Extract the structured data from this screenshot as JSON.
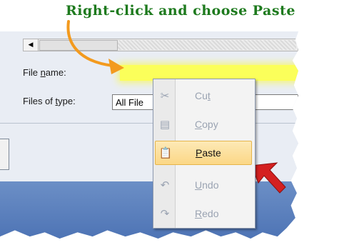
{
  "caption": {
    "text": "Right-click and choose Paste",
    "color": "#1e7a1e"
  },
  "dialog": {
    "scroll_left_glyph": "◀",
    "file_name_label_pre": "File ",
    "file_name_label_u": "n",
    "file_name_label_post": "ame:",
    "files_of_type_label_pre": "Files of ",
    "files_of_type_label_u": "t",
    "files_of_type_label_post": "ype:",
    "files_of_type_value": "All File",
    "input_highlight_color": "#fbff5a",
    "band_color": "#5a7fbd"
  },
  "context_menu": {
    "items": [
      {
        "label_u": "",
        "label_rest": "Cu",
        "label_u2": "t",
        "icon": "cut-icon",
        "glyph": "✂",
        "enabled": false,
        "highlighted": false
      },
      {
        "label_u": "C",
        "label_rest": "opy",
        "icon": "copy-icon",
        "glyph": "▤",
        "enabled": false,
        "highlighted": false
      },
      {
        "label_u": "P",
        "label_rest": "aste",
        "icon": "paste-icon",
        "glyph": "📋",
        "enabled": true,
        "highlighted": true
      },
      {
        "label_u": "U",
        "label_rest": "ndo",
        "icon": "undo-icon",
        "glyph": "↶",
        "enabled": false,
        "highlighted": false
      },
      {
        "label_u": "R",
        "label_rest": "edo",
        "icon": "redo-icon",
        "glyph": "↷",
        "enabled": false,
        "highlighted": false
      }
    ]
  },
  "arrows": {
    "orange": "#f39a1e",
    "red": "#d42020"
  }
}
